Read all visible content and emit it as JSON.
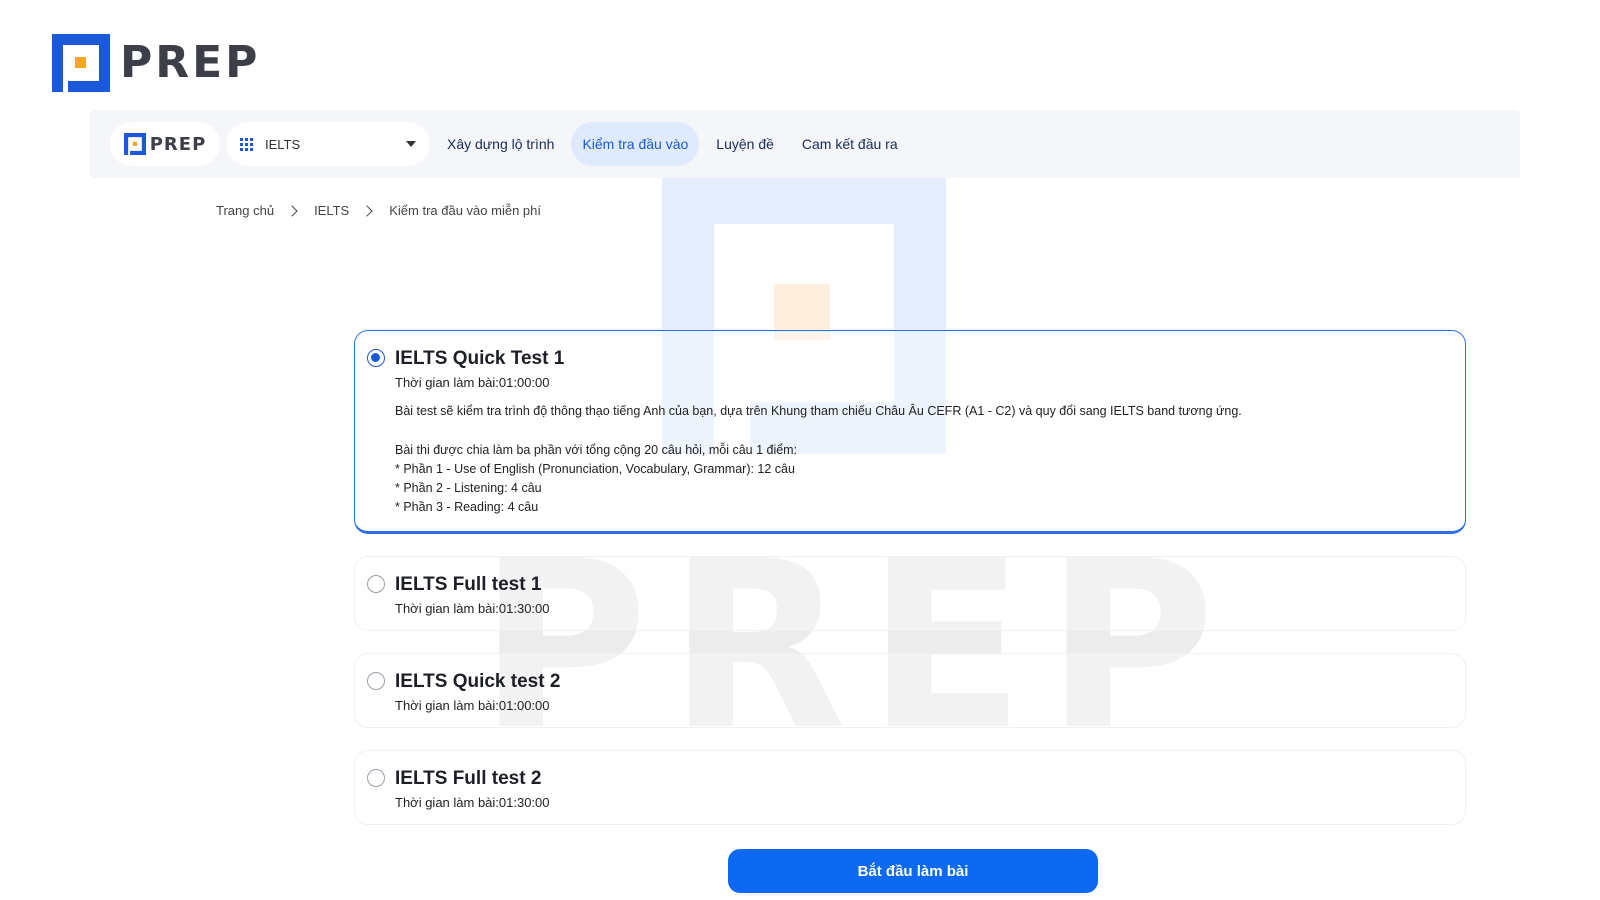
{
  "brand": {
    "logo_text": "PREP",
    "nav_logo_text": "PREP",
    "watermark_text": "PREP",
    "primary_color": "#1a5ad8",
    "accent_color": "#f5a623"
  },
  "nav": {
    "select": {
      "icon": "grid-icon",
      "value": "IELTS"
    },
    "links": [
      {
        "label": "Xây dựng lộ trình",
        "active": false
      },
      {
        "label": "Kiểm tra đầu vào",
        "active": true
      },
      {
        "label": "Luyện đề",
        "active": false
      },
      {
        "label": "Cam kết đầu ra",
        "active": false
      }
    ]
  },
  "breadcrumb": [
    "Trang chủ",
    "IELTS",
    "Kiểm tra đầu vào miễn phí"
  ],
  "tests": [
    {
      "title": "IELTS Quick Test 1",
      "time": "Thời gian làm bài:01:00:00",
      "selected": true,
      "description": "Bài test sẽ kiểm tra trình độ thông thạo tiếng Anh của bạn, dựa trên Khung tham chiếu Châu Âu CEFR (A1 - C2) và quy đổi sang IELTS band tương ứng.",
      "structure_intro": "Bài thi được chia làm ba phần với tổng cộng 20 câu hỏi, mỗi câu 1 điểm:",
      "parts": [
        "* Phần 1 - Use of English (Pronunciation, Vocabulary, Grammar): 12 câu",
        "* Phần 2 - Listening: 4 câu",
        "* Phần 3 - Reading: 4 câu"
      ]
    },
    {
      "title": "IELTS Full test 1",
      "time": "Thời gian làm bài:01:30:00",
      "selected": false
    },
    {
      "title": "IELTS Quick test 2",
      "time": "Thời gian làm bài:01:00:00",
      "selected": false
    },
    {
      "title": "IELTS Full test 2",
      "time": "Thời gian làm bài:01:30:00",
      "selected": false
    }
  ],
  "start_button": {
    "label": "Bắt đầu làm bài"
  }
}
